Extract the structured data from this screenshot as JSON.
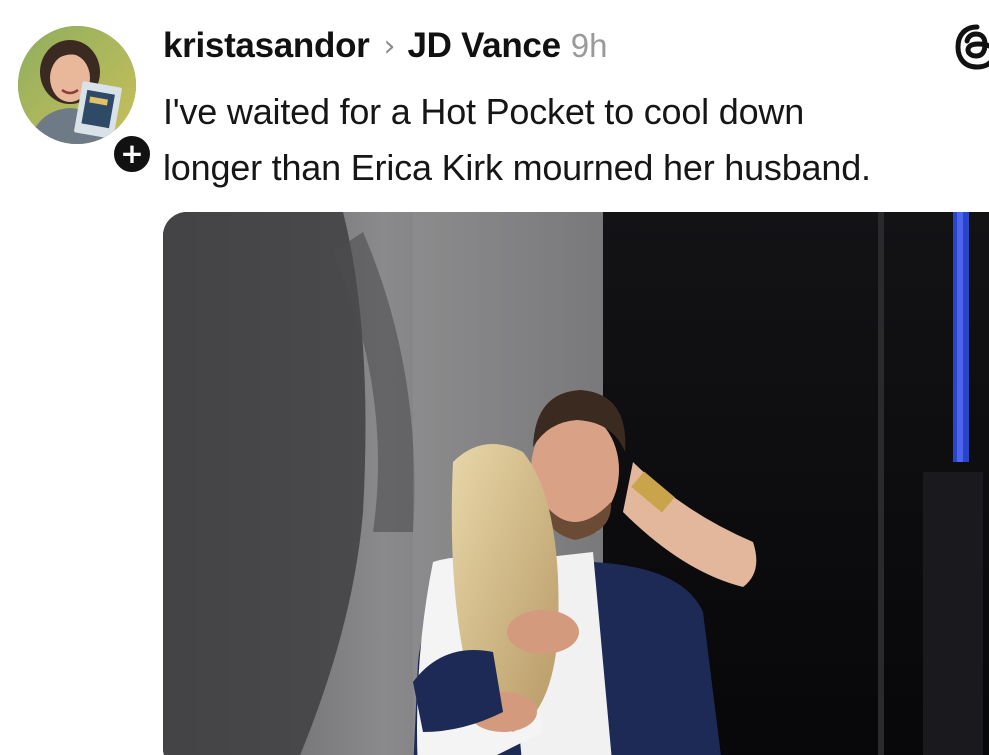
{
  "post": {
    "author": {
      "username": "kristasandor",
      "avatar_icon": "profile-photo",
      "follow_icon": "plus-icon",
      "follow_symbol": "+"
    },
    "separator": "›",
    "reply_to": "JD Vance",
    "timestamp": "9h",
    "app_icon": "threads-logo-icon",
    "text_lines": [
      "I've waited for a Hot Pocket to cool down",
      "longer than Erica Kirk mourned her husband."
    ],
    "media": {
      "type": "photo",
      "subject": "two people embracing on a stage"
    }
  },
  "colors": {
    "text": "#161616",
    "muted": "#9a9a9a",
    "background": "#ffffff"
  }
}
